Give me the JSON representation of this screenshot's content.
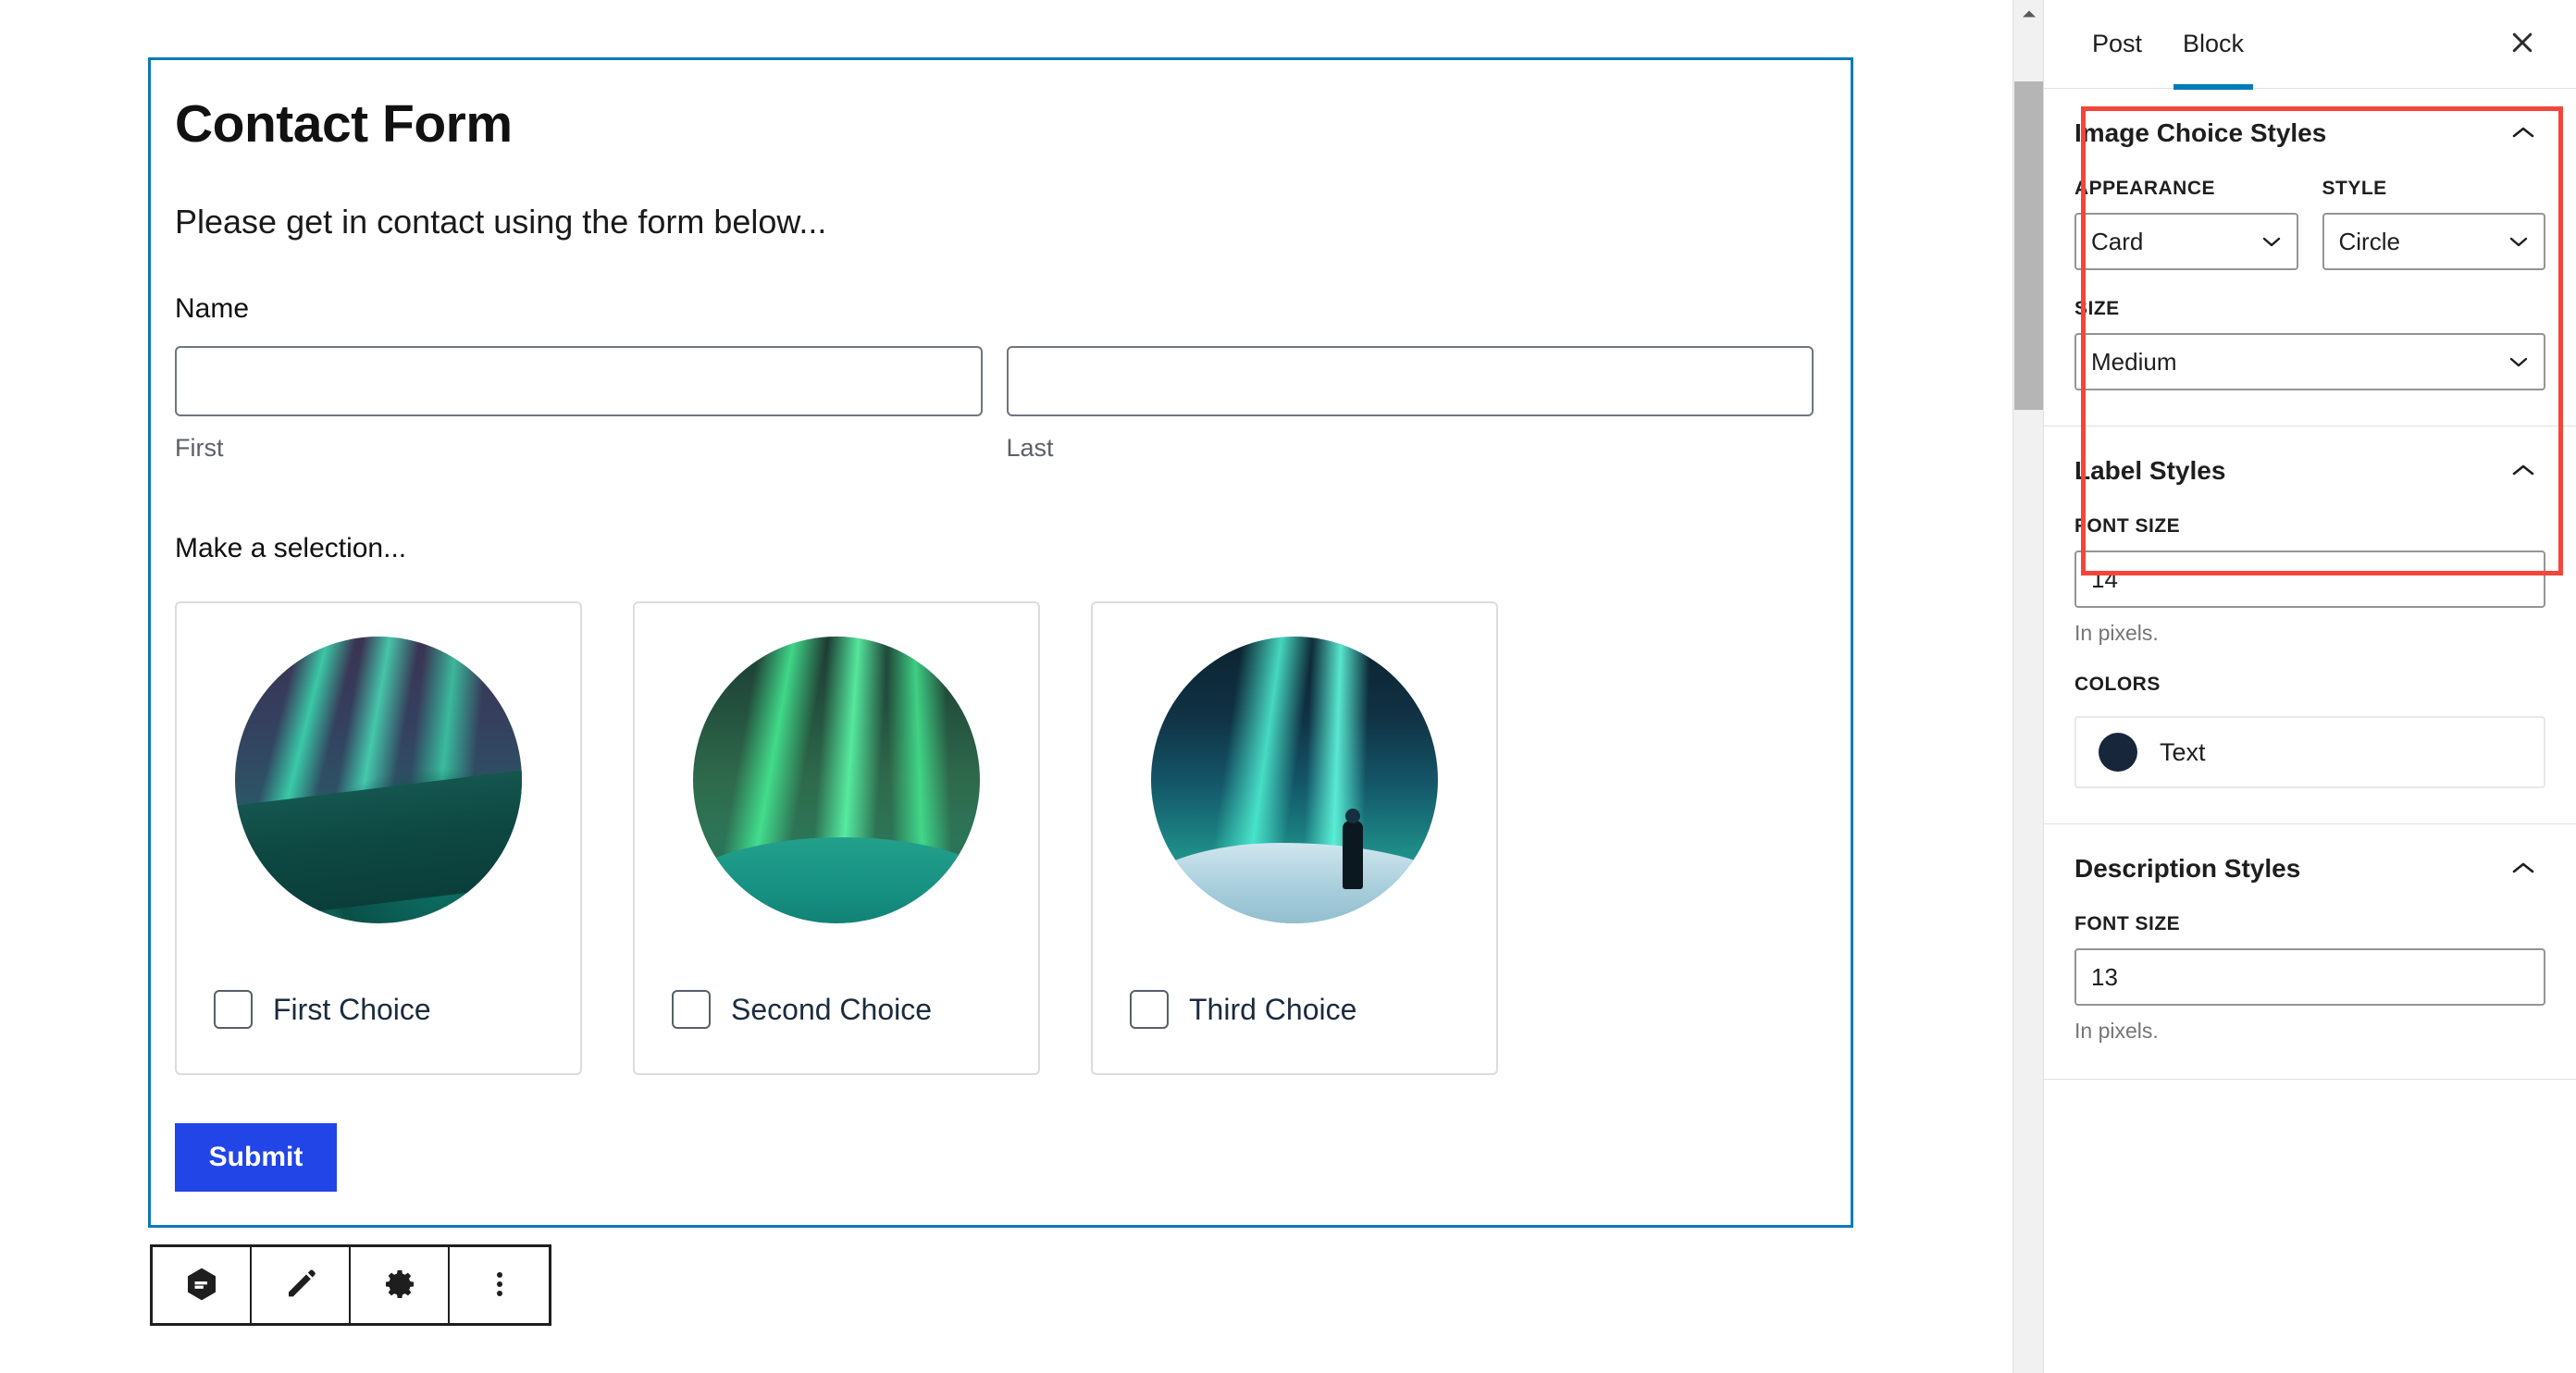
{
  "editor": {
    "form": {
      "title": "Contact Form",
      "description": "Please get in contact using the form below...",
      "name_field": {
        "label": "Name",
        "first_sublabel": "First",
        "last_sublabel": "Last",
        "first_value": "",
        "last_value": ""
      },
      "selection_label": "Make a selection...",
      "choices": [
        {
          "label": "First Choice",
          "checked": false,
          "image": "aurora-over-ridge"
        },
        {
          "label": "Second Choice",
          "checked": false,
          "image": "aurora-over-snow"
        },
        {
          "label": "Third Choice",
          "checked": false,
          "image": "aurora-with-person"
        }
      ],
      "submit_label": "Submit"
    },
    "toolbar": [
      {
        "name": "form-block-icon",
        "label": "Form block"
      },
      {
        "name": "edit-pencil-icon",
        "label": "Edit"
      },
      {
        "name": "gear-icon",
        "label": "Settings"
      },
      {
        "name": "more-options-icon",
        "label": "Options"
      }
    ]
  },
  "sidebar": {
    "tabs": [
      {
        "label": "Post",
        "active": false
      },
      {
        "label": "Block",
        "active": true
      }
    ],
    "close_label": "Close settings",
    "panels": [
      {
        "title": "Image Choice Styles",
        "highlighted": true,
        "controls": {
          "appearance_label": "APPEARANCE",
          "appearance_value": "Card",
          "style_label": "STYLE",
          "style_value": "Circle",
          "size_label": "SIZE",
          "size_value": "Medium"
        }
      },
      {
        "title": "Label Styles",
        "highlighted": true,
        "controls": {
          "font_size_label": "FONT SIZE",
          "font_size_value": "14",
          "font_size_hint": "In pixels.",
          "colors_label": "COLORS",
          "color_name": "Text",
          "color_value": "#18263b"
        }
      },
      {
        "title": "Description Styles",
        "highlighted": false,
        "controls": {
          "font_size_label": "FONT SIZE",
          "font_size_value": "13",
          "font_size_hint": "In pixels."
        }
      }
    ]
  },
  "colors": {
    "accent_blue": "#007cba",
    "canvas_border": "#0c7ab8",
    "submit_blue": "#2145e6",
    "annotation_red": "#f5453a",
    "label_text": "#1c2b3d"
  }
}
